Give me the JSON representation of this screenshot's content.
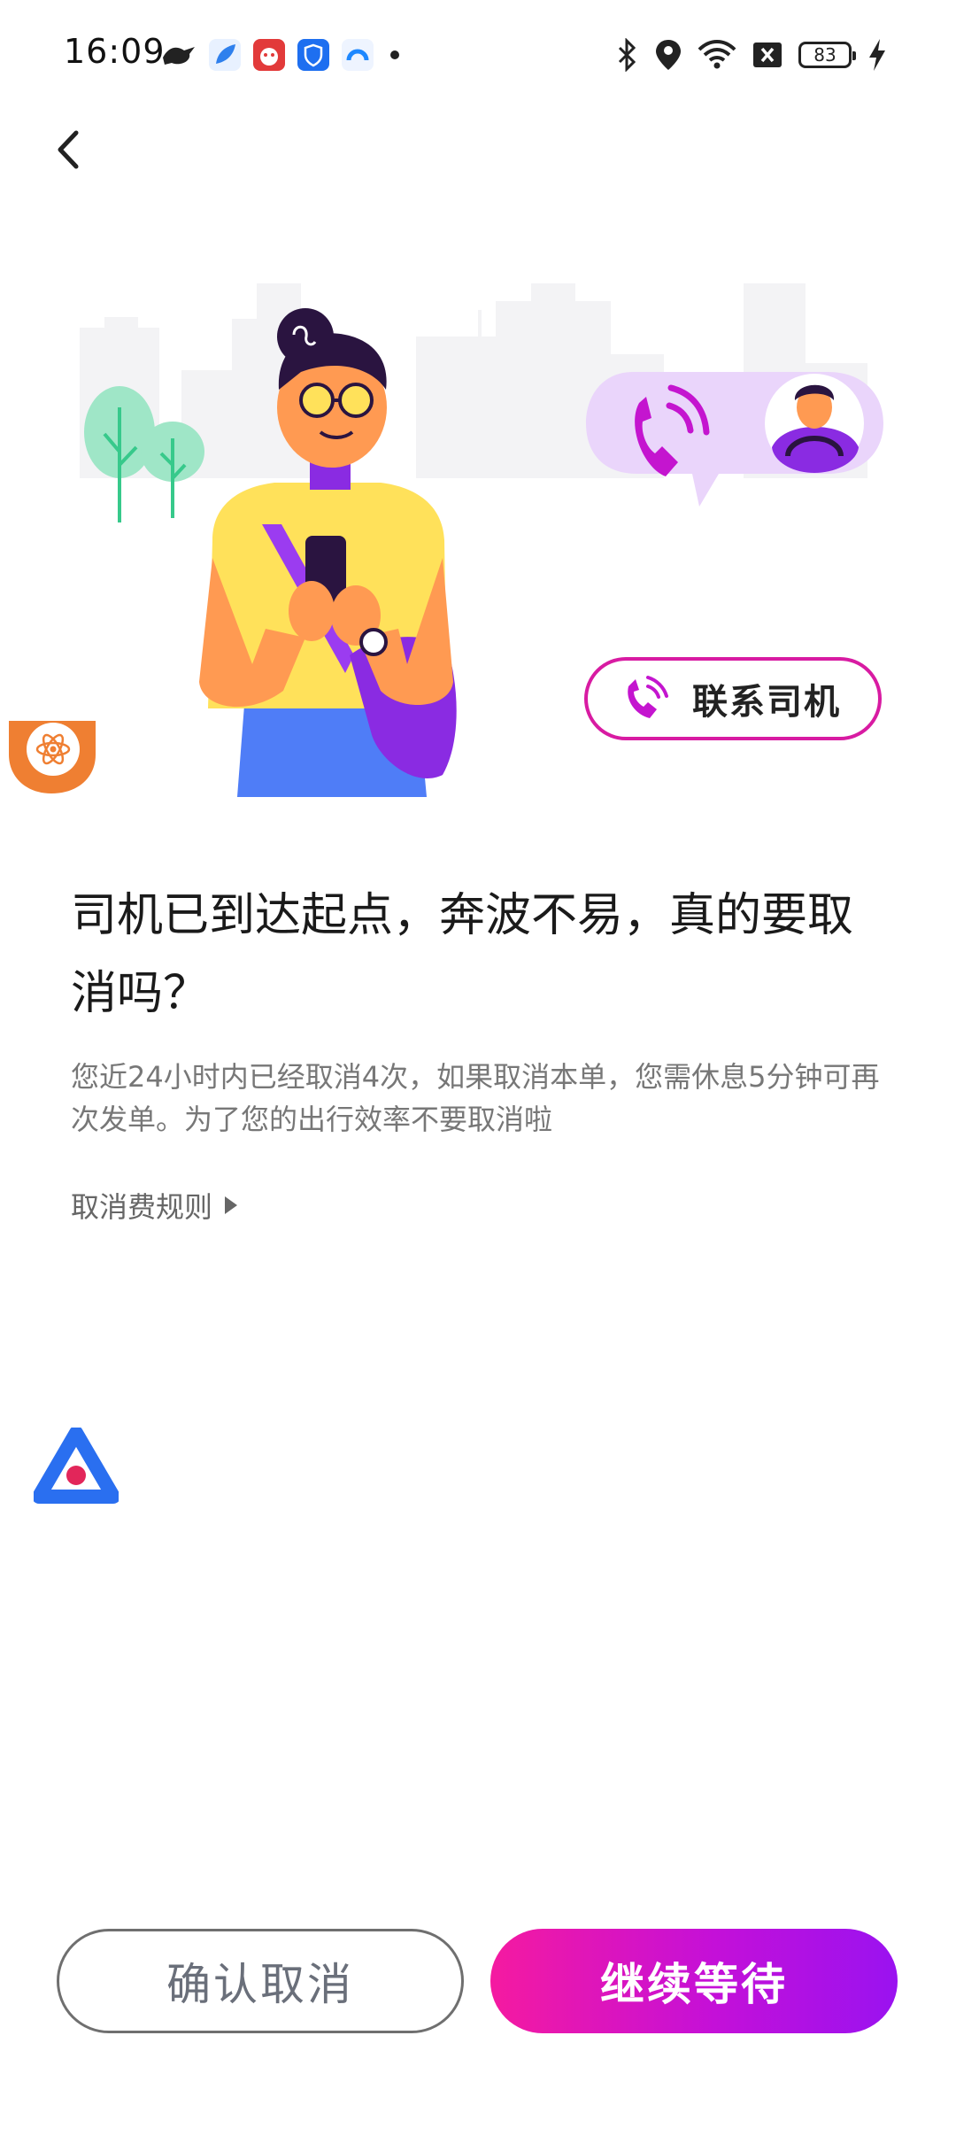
{
  "status_bar": {
    "time": "16:09",
    "notification_icons": [
      "bird-app-icon",
      "feather-app-icon",
      "shopping-618-app-icon",
      "shield-app-icon",
      "cloud-app-icon",
      "more-dot-icon"
    ],
    "system_icons": [
      "bluetooth-icon",
      "location-icon",
      "wifi-icon",
      "sim-off-icon"
    ],
    "battery_level": "83",
    "charging": true
  },
  "header": {
    "back_icon": "chevron-left-icon"
  },
  "illustration": {
    "contact_driver_label": "联系司机",
    "call_icon": "phone-call-icon"
  },
  "main": {
    "title": "司机已到达起点，奔波不易，真的要取消吗？",
    "description": "您近24小时内已经取消4次，如果取消本单，您需休息5分钟可再次发单。为了您的出行效率不要取消啦",
    "rules_link": "取消费规则"
  },
  "buttons": {
    "confirm_cancel": "确认取消",
    "continue_wait": "继续等待"
  },
  "colors": {
    "accent_magenta": "#f51aa0",
    "accent_purple": "#9a12f0",
    "pill_border": "#d81ba2"
  }
}
